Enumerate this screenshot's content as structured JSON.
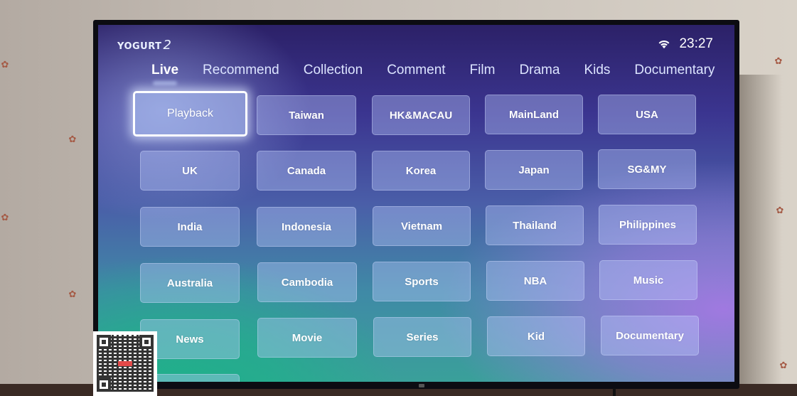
{
  "app": {
    "logo_text": "YOGURT",
    "logo_number": "2"
  },
  "status": {
    "wifi_icon": "wifi-icon",
    "time": "23:27"
  },
  "nav": {
    "tabs": [
      {
        "label": "Live",
        "active": true
      },
      {
        "label": "Recommend",
        "active": false
      },
      {
        "label": "Collection",
        "active": false
      },
      {
        "label": "Comment",
        "active": false
      },
      {
        "label": "Film",
        "active": false
      },
      {
        "label": "Drama",
        "active": false
      },
      {
        "label": "Kids",
        "active": false
      },
      {
        "label": "Documentary",
        "active": false
      }
    ]
  },
  "categories": {
    "focused": "Playback",
    "rows": [
      [
        "Playback",
        "Taiwan",
        "HK&MACAU",
        "MainLand",
        "USA"
      ],
      [
        "UK",
        "Canada",
        "Korea",
        "Japan",
        "SG&MY"
      ],
      [
        "India",
        "Indonesia",
        "Vietnam",
        "Thailand",
        "Philippines"
      ],
      [
        "Australia",
        "Cambodia",
        "Sports",
        "NBA",
        "Music"
      ],
      [
        "News",
        "Movie",
        "Series",
        "Kid",
        "Documentary"
      ]
    ]
  },
  "overlay": {
    "qr_icon": "qr-code-icon"
  }
}
